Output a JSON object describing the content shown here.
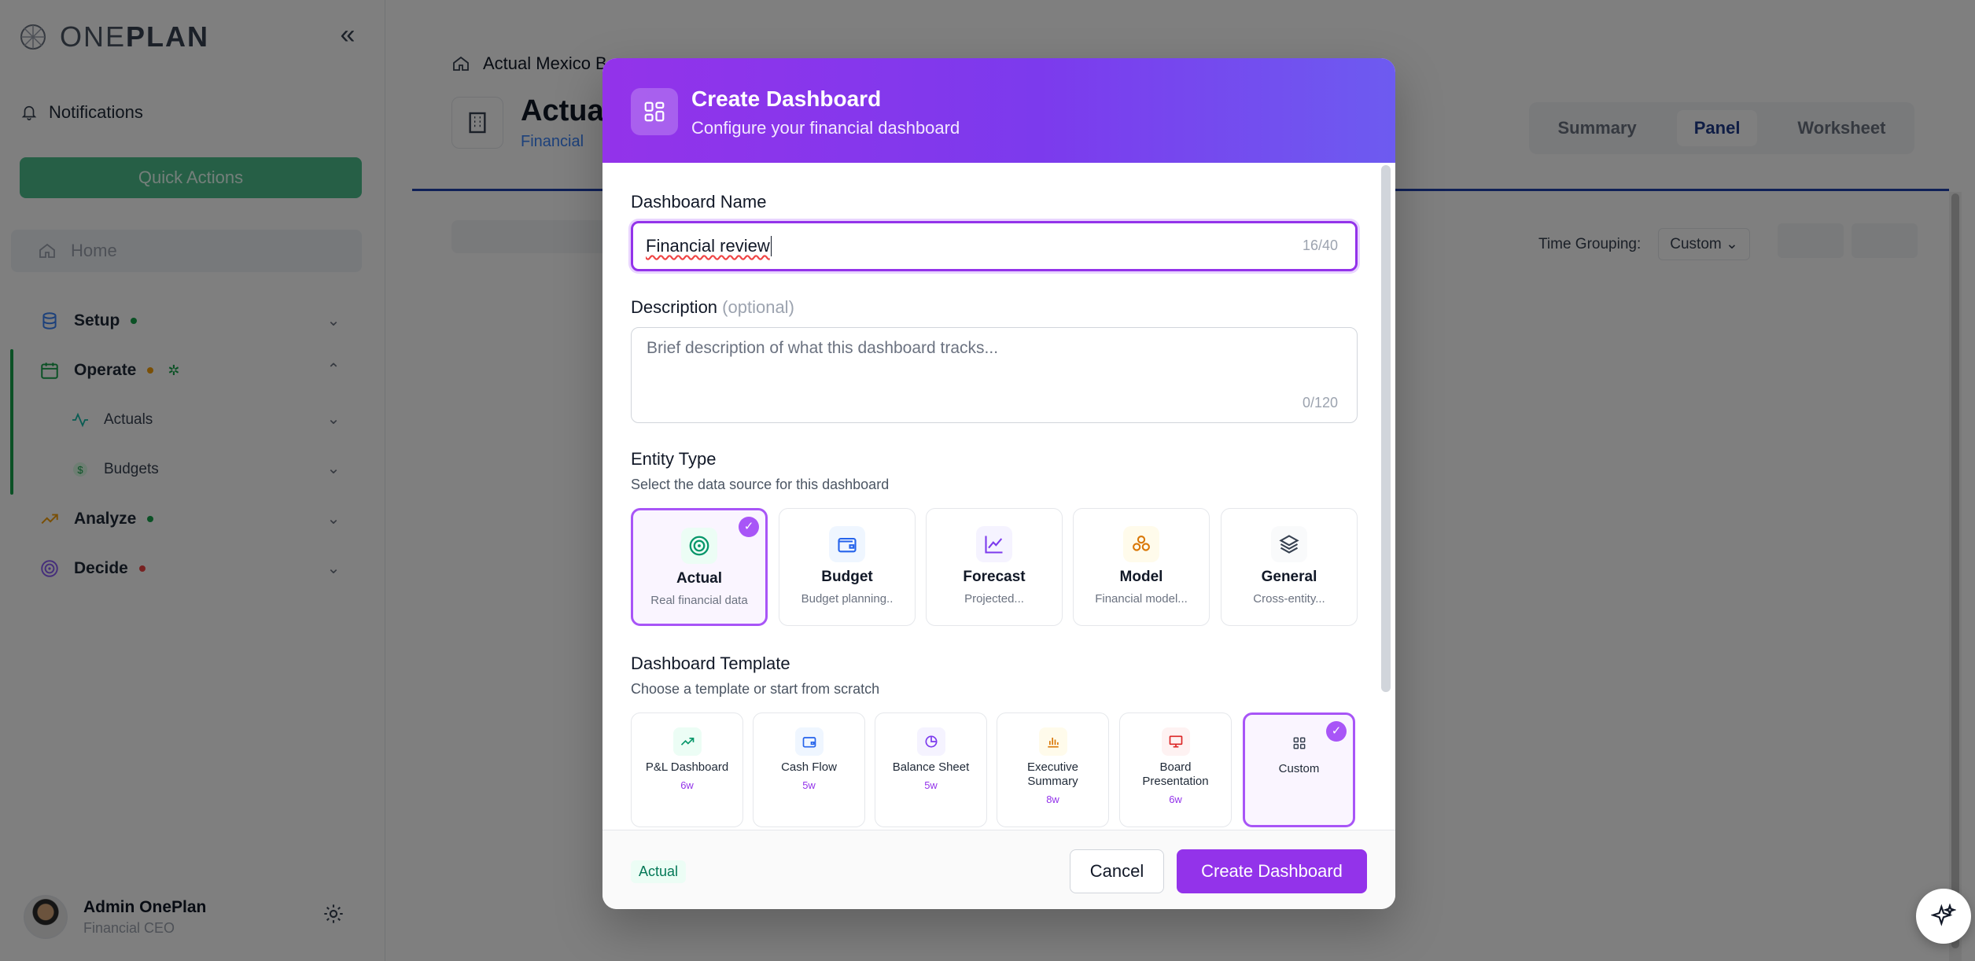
{
  "app": {
    "logo_prefix": "ONE",
    "logo_suffix": "PLAN"
  },
  "sidebar": {
    "notifications": "Notifications",
    "quick_actions": "Quick Actions",
    "home": "Home",
    "items": [
      {
        "label": "Setup",
        "dot_color": "#16a34a"
      },
      {
        "label": "Operate",
        "dot_color": "#f59e0b"
      },
      {
        "label": "Analyze",
        "dot_color": "#16a34a"
      },
      {
        "label": "Decide",
        "dot_color": "#ef4444"
      }
    ],
    "sub_items": [
      {
        "label": "Actuals"
      },
      {
        "label": "Budgets"
      }
    ],
    "user": {
      "name": "Admin OnePlan",
      "role": "Financial CEO"
    }
  },
  "main": {
    "breadcrumb": "Actual Mexico B",
    "title": "Actua",
    "subtitle": "Financial",
    "tabs": [
      {
        "label": "Summary"
      },
      {
        "label": "Panel"
      },
      {
        "label": "Worksheet"
      }
    ],
    "time_grouping_label": "Time Grouping:",
    "time_grouping_value": "Custom"
  },
  "modal": {
    "title": "Create Dashboard",
    "subtitle": "Configure your financial dashboard",
    "name_label": "Dashboard Name",
    "name_value": "Financial review",
    "name_counter": "16/40",
    "desc_label": "Description",
    "desc_optional": "(optional)",
    "desc_placeholder": "Brief description of what this dashboard tracks...",
    "desc_counter": "0/120",
    "entity_label": "Entity Type",
    "entity_hint": "Select the data source for this dashboard",
    "entity_types": [
      {
        "name": "Actual",
        "desc": "Real financial data",
        "icon": "target-icon",
        "selected": true
      },
      {
        "name": "Budget",
        "desc": "Budget planning..",
        "icon": "wallet-icon",
        "selected": false
      },
      {
        "name": "Forecast",
        "desc": "Projected...",
        "icon": "line-chart-icon",
        "selected": false
      },
      {
        "name": "Model",
        "desc": "Financial model...",
        "icon": "boxes-icon",
        "selected": false
      },
      {
        "name": "General",
        "desc": "Cross-entity...",
        "icon": "layers-icon",
        "selected": false
      }
    ],
    "template_label": "Dashboard Template",
    "template_hint": "Choose a template or start from scratch",
    "templates": [
      {
        "name": "P&L Dashboard",
        "weeks": "6w",
        "icon": "trending-up-icon",
        "selected": false
      },
      {
        "name": "Cash Flow",
        "weeks": "5w",
        "icon": "wallet-icon",
        "selected": false
      },
      {
        "name": "Balance Sheet",
        "weeks": "5w",
        "icon": "pie-chart-icon",
        "selected": false
      },
      {
        "name": "Executive Summary",
        "weeks": "8w",
        "icon": "bar-chart-icon",
        "selected": false
      },
      {
        "name": "Board Presentation",
        "weeks": "6w",
        "icon": "presentation-icon",
        "selected": false
      },
      {
        "name": "Custom",
        "weeks": "",
        "icon": "grid-icon",
        "selected": true
      }
    ],
    "footer_badge": "Actual",
    "cancel": "Cancel",
    "create": "Create Dashboard"
  },
  "colors": {
    "accent": "#9333ea",
    "quick_actions": "#4cbe8d",
    "header_line": "#1e40af"
  }
}
